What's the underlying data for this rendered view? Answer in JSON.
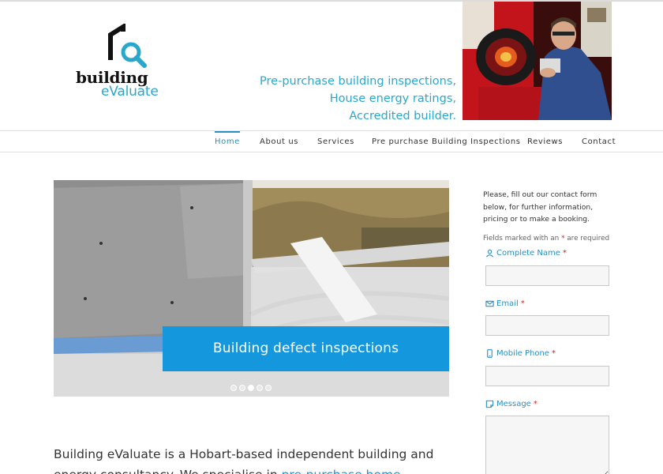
{
  "brand": {
    "logo_word1": "building",
    "logo_word2": "eValuate",
    "accent_color": "#2aa7cc",
    "logo_mark_icon": "house-magnifier-icon"
  },
  "tagline": {
    "line1": "Pre-purchase building inspections,",
    "line2": "House energy ratings,",
    "line3": "Accredited builder."
  },
  "nav": {
    "items": [
      {
        "label": "Home",
        "active": true
      },
      {
        "label": "About us"
      },
      {
        "label": "Services"
      },
      {
        "label": "Pre purchase Building Inspections"
      },
      {
        "label": "Reviews"
      },
      {
        "label": "Contact"
      }
    ],
    "active_color": "#2a8fc4"
  },
  "slider": {
    "caption": "Building defect inspections",
    "caption_color": "#1497dc",
    "dot_count": 5,
    "active_dot": 2
  },
  "intro": {
    "text_before_link": "Building eValuate is a Hobart-based independent building and energy consultancy. We specialise in ",
    "link_text": "pre-purchase home"
  },
  "contact_form": {
    "intro_text": "Please, fill out our contact form below, for further information, pricing or to make a booking.",
    "note_before": "Fields marked with an ",
    "note_star": "*",
    "note_after": " are required",
    "fields": [
      {
        "label": "Complete Name",
        "icon": "user-icon",
        "required_mark": "*",
        "value": "",
        "placeholder": ""
      },
      {
        "label": "Email",
        "icon": "envelope-icon",
        "required_mark": "*",
        "value": "",
        "placeholder": ""
      },
      {
        "label": "Mobile Phone",
        "icon": "mobile-phone-icon",
        "required_mark": "*",
        "value": "",
        "placeholder": ""
      },
      {
        "label": "Message",
        "icon": "note-icon",
        "required_mark": "*",
        "value": "",
        "placeholder": ""
      }
    ]
  }
}
